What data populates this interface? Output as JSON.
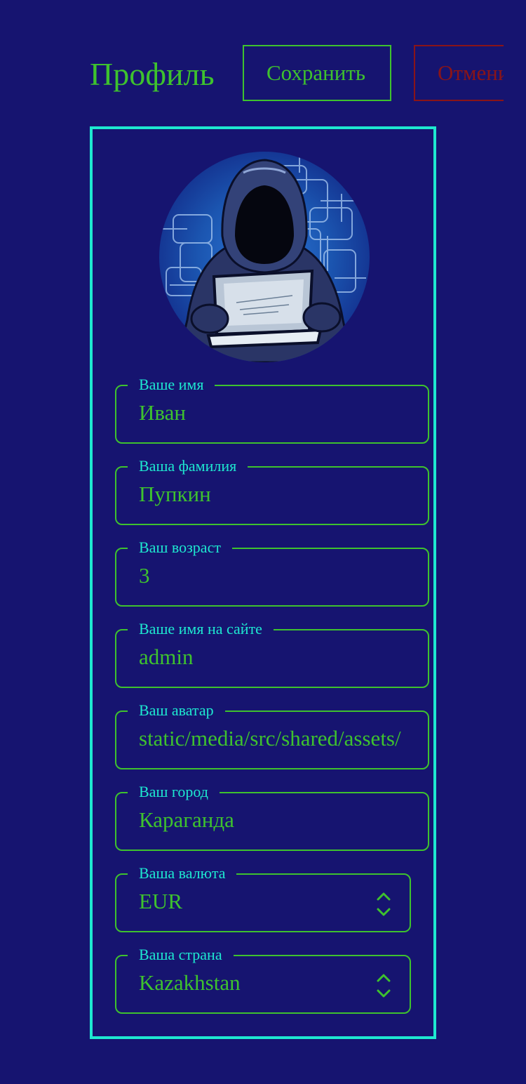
{
  "header": {
    "title": "Профиль",
    "save_label": "Сохранить",
    "cancel_label": "Отмени"
  },
  "form": {
    "first_name": {
      "label": "Ваше имя",
      "value": "Иван"
    },
    "last_name": {
      "label": "Ваша фамилия",
      "value": "Пупкин"
    },
    "age": {
      "label": "Ваш возраст",
      "value": "3"
    },
    "username": {
      "label": "Ваше имя на сайте",
      "value": "admin"
    },
    "avatar": {
      "label": "Ваш аватар",
      "value": "static/media/src/shared/assets/"
    },
    "city": {
      "label": "Ваш город",
      "value": "Караганда"
    },
    "currency": {
      "label": "Ваша валюта",
      "value": "EUR"
    },
    "country": {
      "label": "Ваша страна",
      "value": "Kazakhstan"
    }
  },
  "colors": {
    "background": "#161470",
    "accent_green": "#3ec22e",
    "accent_cyan": "#1ee8d0",
    "cancel_red": "#8a1418"
  },
  "icons": {
    "avatar_image": "hooded-hacker-with-laptop",
    "select_arrows": "chevron-up-down-icon"
  }
}
